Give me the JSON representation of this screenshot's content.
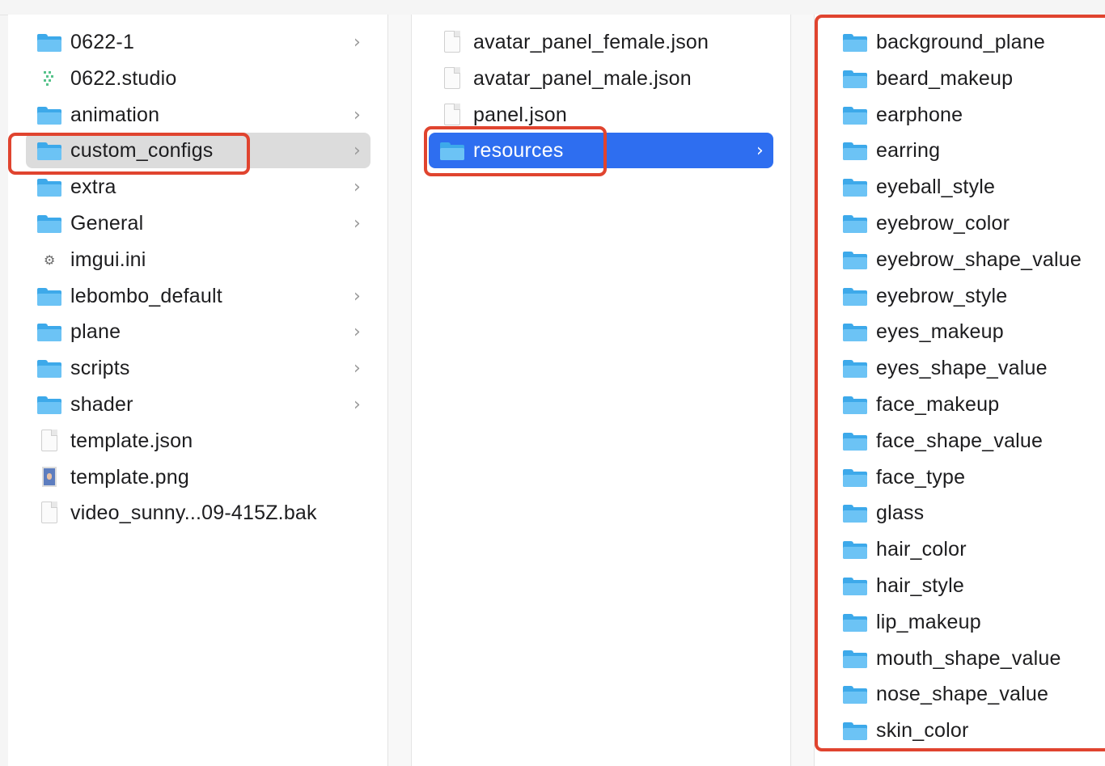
{
  "column1": {
    "items": [
      {
        "name": "0622-1",
        "type": "folder",
        "chevron": true
      },
      {
        "name": "0622.studio",
        "type": "studio",
        "chevron": false
      },
      {
        "name": "animation",
        "type": "folder",
        "chevron": true
      },
      {
        "name": "custom_configs",
        "type": "folder",
        "chevron": true,
        "selected": "gray"
      },
      {
        "name": "extra",
        "type": "folder",
        "chevron": true
      },
      {
        "name": "General",
        "type": "folder",
        "chevron": true
      },
      {
        "name": "imgui.ini",
        "type": "gear",
        "chevron": false
      },
      {
        "name": "lebombo_default",
        "type": "folder",
        "chevron": true
      },
      {
        "name": "plane",
        "type": "folder",
        "chevron": true
      },
      {
        "name": "scripts",
        "type": "folder",
        "chevron": true
      },
      {
        "name": "shader",
        "type": "folder",
        "chevron": true
      },
      {
        "name": "template.json",
        "type": "doc",
        "chevron": false
      },
      {
        "name": "template.png",
        "type": "png",
        "chevron": false
      },
      {
        "name": "video_sunny...09-415Z.bak",
        "type": "doc",
        "chevron": false
      }
    ]
  },
  "column2": {
    "items": [
      {
        "name": "avatar_panel_female.json",
        "type": "doc",
        "chevron": false
      },
      {
        "name": "avatar_panel_male.json",
        "type": "doc",
        "chevron": false
      },
      {
        "name": "panel.json",
        "type": "doc",
        "chevron": false
      },
      {
        "name": "resources",
        "type": "folder",
        "chevron": true,
        "selected": "blue"
      }
    ]
  },
  "column3": {
    "items": [
      {
        "name": "background_plane",
        "type": "folder"
      },
      {
        "name": "beard_makeup",
        "type": "folder"
      },
      {
        "name": "earphone",
        "type": "folder"
      },
      {
        "name": "earring",
        "type": "folder"
      },
      {
        "name": "eyeball_style",
        "type": "folder"
      },
      {
        "name": "eyebrow_color",
        "type": "folder"
      },
      {
        "name": "eyebrow_shape_value",
        "type": "folder"
      },
      {
        "name": "eyebrow_style",
        "type": "folder"
      },
      {
        "name": "eyes_makeup",
        "type": "folder"
      },
      {
        "name": "eyes_shape_value",
        "type": "folder"
      },
      {
        "name": "face_makeup",
        "type": "folder"
      },
      {
        "name": "face_shape_value",
        "type": "folder"
      },
      {
        "name": "face_type",
        "type": "folder"
      },
      {
        "name": "glass",
        "type": "folder"
      },
      {
        "name": "hair_color",
        "type": "folder"
      },
      {
        "name": "hair_style",
        "type": "folder"
      },
      {
        "name": "lip_makeup",
        "type": "folder"
      },
      {
        "name": "mouth_shape_value",
        "type": "folder"
      },
      {
        "name": "nose_shape_value",
        "type": "folder"
      },
      {
        "name": "skin_color",
        "type": "folder"
      }
    ]
  },
  "chevron_glyph": "›",
  "colors": {
    "selection_blue": "#2e6ef0",
    "selection_gray": "#dcdcdc",
    "highlight_red": "#e0442f",
    "folder_blue": "#6cc3f5"
  }
}
